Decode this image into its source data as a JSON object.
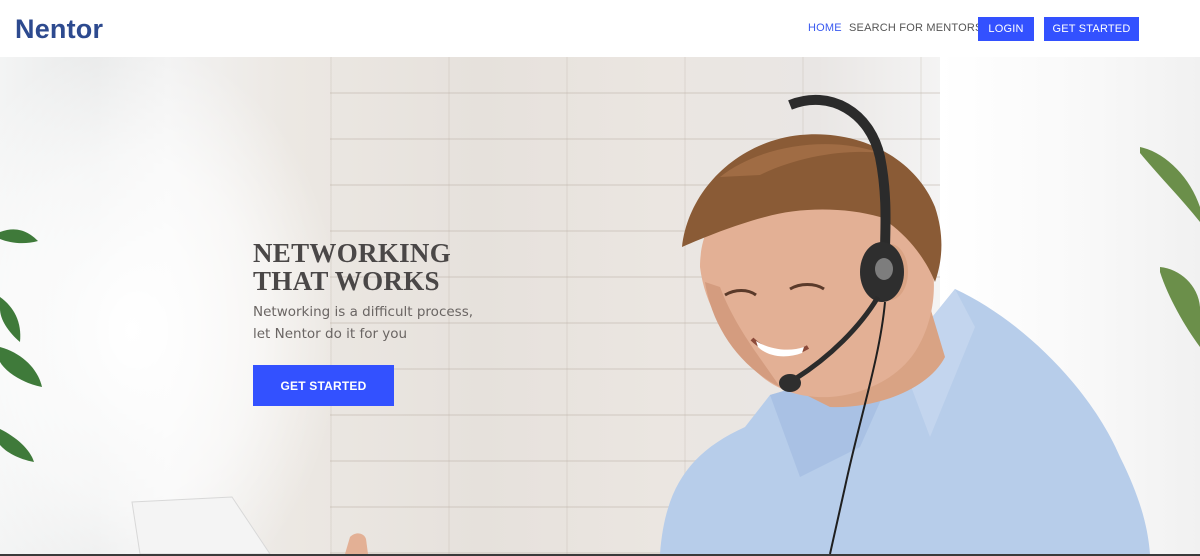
{
  "navbar": {
    "brand": "Nentor",
    "links": [
      {
        "label": "HOME",
        "active": true
      },
      {
        "label": "SEARCH FOR MENTORS",
        "active": false
      }
    ],
    "login_label": "LOGIN",
    "get_started_label": "GET STARTED"
  },
  "hero": {
    "title_line_1": "NETWORKING",
    "title_line_2": "THAT WORKS",
    "subtitle_line_1": "Networking is a difficult process,",
    "subtitle_line_2": "let Nentor do it for you",
    "cta_label": "GET STARTED"
  },
  "colors": {
    "brand": "#2d4a8f",
    "accent": "#3351ff",
    "active_link": "#3a5af0",
    "title_text": "#4a4747"
  },
  "icons": {
    "hero_image": "man-with-headset-photo"
  }
}
